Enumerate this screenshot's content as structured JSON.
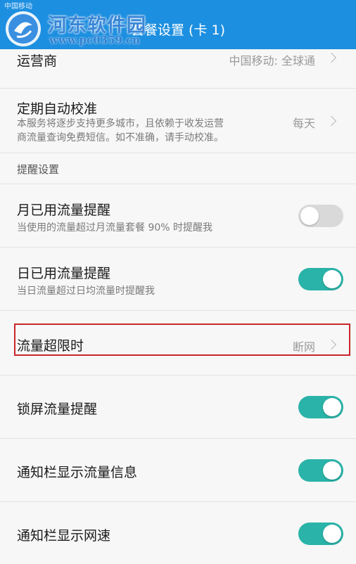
{
  "status_bar": {
    "text": "中国移动"
  },
  "header": {
    "title": "套餐设置 (卡 1)"
  },
  "watermark": {
    "name": "河东软件园",
    "url": "www.pc0359.cn"
  },
  "colors": {
    "header": "#1d8fe0",
    "toggle_on": "#2ab3a8",
    "toggle_off": "#d9d9d9",
    "highlight": "#c8262b"
  },
  "rows": {
    "operator": {
      "title": "运营商",
      "value": "中国移动: 全球通"
    },
    "auto_calibrate": {
      "title": "定期自动校准",
      "desc_line1": "本服务将逐步支持更多城市，且依赖于收发运营",
      "desc_line2": "商流量查询免费短信。如不准确，请手动校准。",
      "value": "每天"
    },
    "reminder_section": {
      "label": "提醒设置"
    },
    "monthly_alert": {
      "title": "月已用流量提醒",
      "desc": "当使用的流量超过月流量套餐 90% 时提醒我",
      "enabled": false
    },
    "daily_alert": {
      "title": "日已用流量提醒",
      "desc": "当日流量超过日均流量时提醒我",
      "enabled": true
    },
    "over_limit": {
      "title": "流量超限时",
      "value": "断网"
    },
    "lock_screen": {
      "title": "锁屏流量提醒",
      "enabled": true
    },
    "notif_info": {
      "title": "通知栏显示流量信息",
      "enabled": true
    },
    "notif_speed": {
      "title": "通知栏显示网速",
      "enabled": true
    }
  }
}
